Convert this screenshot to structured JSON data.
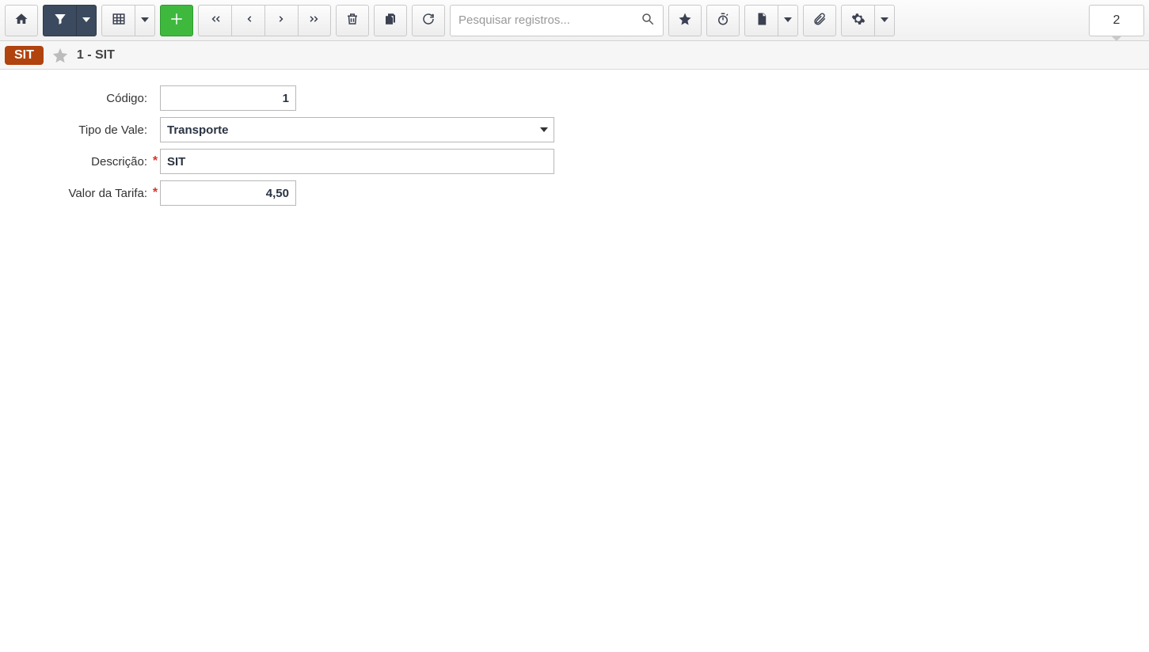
{
  "toolbar": {
    "search_placeholder": "Pesquisar registros...",
    "count": "2"
  },
  "header": {
    "badge": "SIT",
    "title": "1 - SIT"
  },
  "form": {
    "codigo": {
      "label": "Código:",
      "value": "1"
    },
    "tipo_vale": {
      "label": "Tipo de Vale:",
      "value": "Transporte"
    },
    "descricao": {
      "label": "Descrição:",
      "value": "SIT"
    },
    "valor_tarifa": {
      "label": "Valor da Tarifa:",
      "value": "4,50"
    },
    "required_mark": "*"
  }
}
